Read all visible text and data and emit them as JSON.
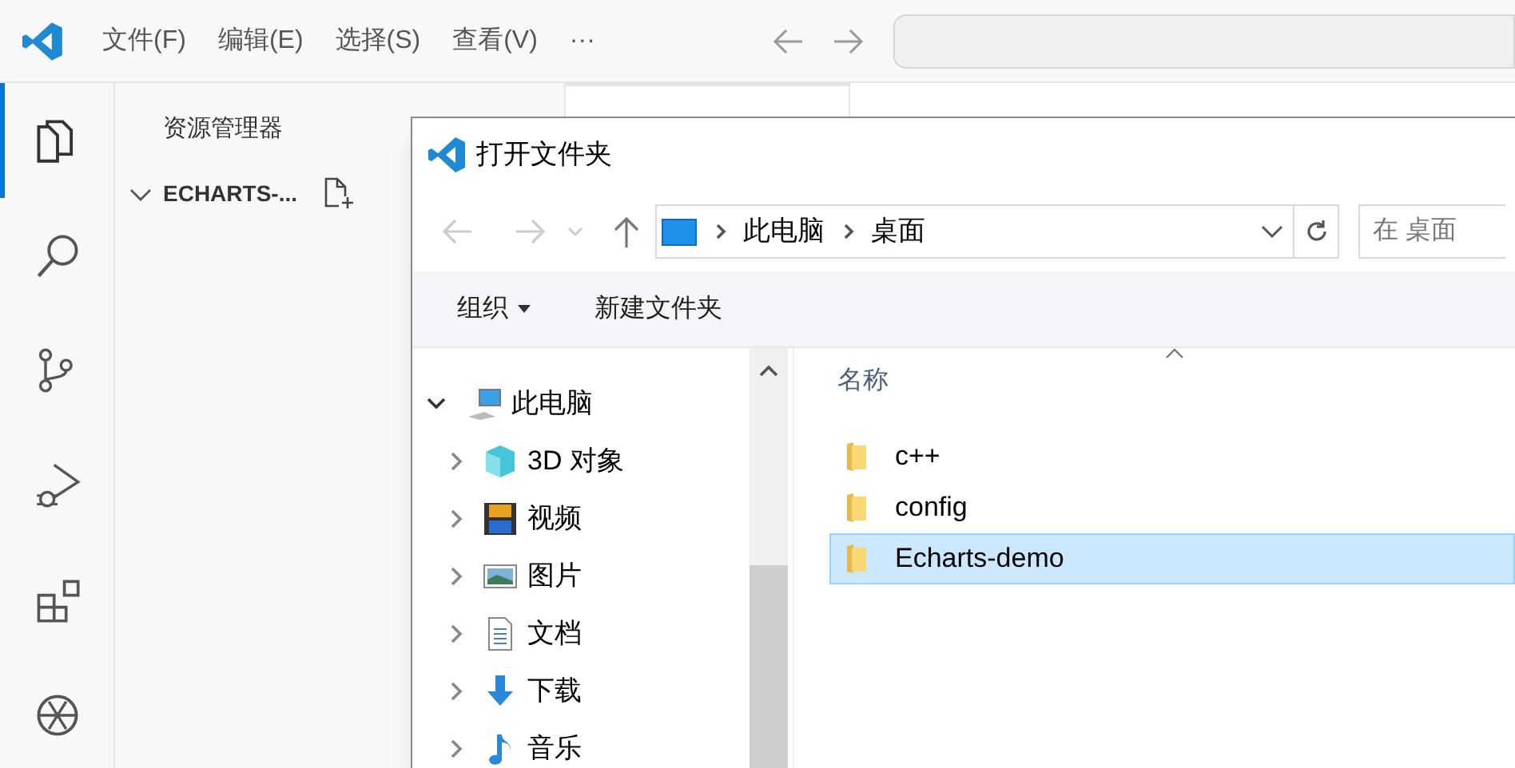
{
  "titlebar": {
    "menus": [
      "文件(F)",
      "编辑(E)",
      "选择(S)",
      "查看(V)",
      "···"
    ]
  },
  "activity_bar": [
    {
      "kind": "explorer",
      "selected": true
    },
    {
      "kind": "search",
      "selected": false
    },
    {
      "kind": "source_control",
      "selected": false
    },
    {
      "kind": "run_debug",
      "selected": false
    },
    {
      "kind": "extensions",
      "selected": false
    },
    {
      "kind": "assistant",
      "selected": false
    }
  ],
  "sidebar": {
    "title": "资源管理器",
    "folder": {
      "label": "ECHARTS-...",
      "expanded": true
    }
  },
  "dialog": {
    "title": "打开文件夹",
    "breadcrumb": [
      "此电脑",
      "桌面"
    ],
    "search": {
      "placeholder": "在 桌面"
    },
    "toolbar": [
      {
        "label": "组织",
        "kind": "menu"
      },
      {
        "label": "新建文件夹",
        "kind": "button"
      }
    ],
    "nav_tree": [
      {
        "label": "此电脑",
        "kind": "pc",
        "expanded": true,
        "children": [
          {
            "label": "3D 对象",
            "kind": "cube",
            "expanded": false
          },
          {
            "label": "视频",
            "kind": "film",
            "expanded": false
          },
          {
            "label": "图片",
            "kind": "image",
            "expanded": false
          },
          {
            "label": "文档",
            "kind": "document",
            "expanded": false
          },
          {
            "label": "下载",
            "kind": "download",
            "expanded": false
          },
          {
            "label": "音乐",
            "kind": "music",
            "expanded": false
          }
        ]
      }
    ],
    "files": {
      "columns": [
        "名称"
      ],
      "rows": [
        {
          "name": "c++",
          "selected": false
        },
        {
          "name": "config",
          "selected": false
        },
        {
          "name": "Echarts-demo",
          "selected": true
        }
      ]
    }
  }
}
